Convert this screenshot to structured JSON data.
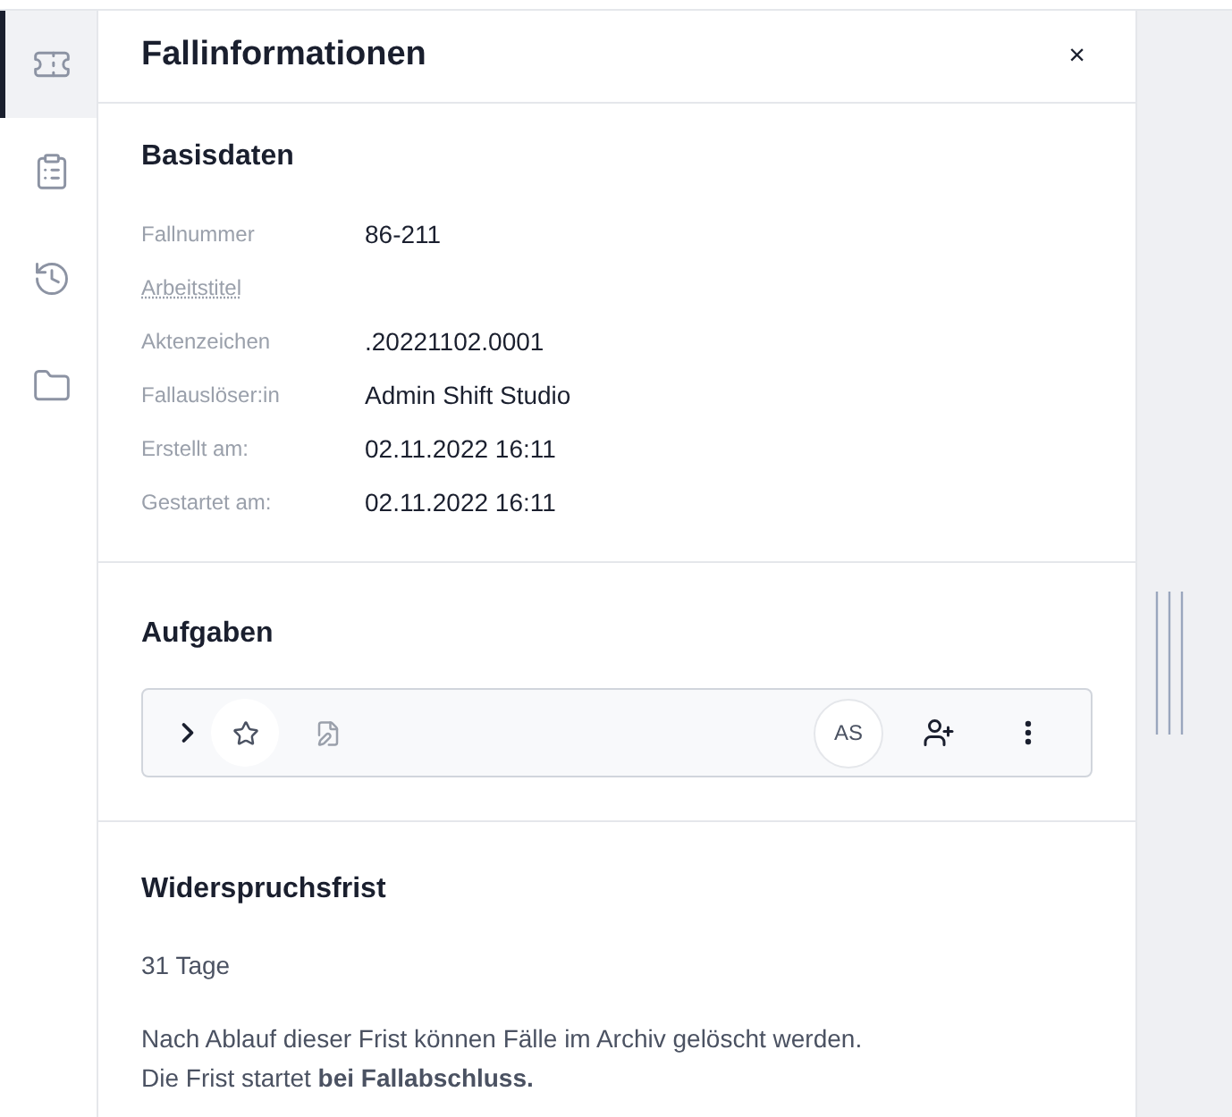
{
  "sidebar": {
    "items": [
      {
        "kind": "ticket",
        "selected": true
      },
      {
        "kind": "clipboard",
        "selected": false
      },
      {
        "kind": "history",
        "selected": false
      },
      {
        "kind": "folder",
        "selected": false
      }
    ]
  },
  "panel": {
    "title": "Fallinformationen",
    "close": "×"
  },
  "basisdaten": {
    "title": "Basisdaten",
    "fields": [
      {
        "label": "Fallnummer",
        "value": "86-211",
        "underlined": false
      },
      {
        "label": "Arbeitstitel",
        "underlined": true
      },
      {
        "label": "Aktenzeichen",
        "value": ".20221102.0001",
        "underlined": false
      },
      {
        "label": "Fallauslöser:in",
        "value": "Admin Shift Studio",
        "underlined": false
      },
      {
        "label": "Erstellt am:",
        "value": "02.11.2022 16:11",
        "underlined": false
      },
      {
        "label": "Gestartet am:",
        "value": "02.11.2022 16:11",
        "underlined": false
      }
    ]
  },
  "aufgaben": {
    "title": "Aufgaben",
    "tasks": [
      {
        "expanded": false,
        "avatar": "AS"
      }
    ]
  },
  "widerspruchsfrist": {
    "title": "Widerspruchsfrist",
    "duration": "31 Tage",
    "notice_lines": [
      "Nach Ablauf dieser Frist können Fälle im Archiv gelöscht werden.",
      "Die Frist startet **bei Fallabschluss.**"
    ]
  }
}
